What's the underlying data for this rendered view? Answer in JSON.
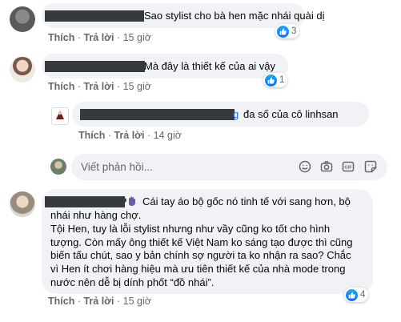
{
  "comments": [
    {
      "text": "Sao stylist cho bà hen mặc nhái quài dị",
      "actions": {
        "like": "Thích",
        "reply": "Trả lời",
        "time": "15 giờ"
      },
      "reaction_count": "3"
    },
    {
      "text": "Mà đây là thiết kế của ai vậy",
      "actions": {
        "like": "Thích",
        "reply": "Trả lời",
        "time": "15 giờ"
      },
      "reaction_count": "1"
    },
    {
      "text": "đa số của cô linhsan",
      "highlight_char": "g",
      "actions": {
        "like": "Thích",
        "reply": "Trả lời",
        "time": "14 giờ"
      }
    },
    {
      "first_line": "Cái tay áo bộ gốc nó tinh tế với sang hơn, bộ",
      "lines": [
        "nhái như hàng chợ.",
        "Tội Hen, tuy là lỗi stylist nhưng như vầy cũng ko tốt cho hình",
        "tượng. Còn mấy ông thiết kế Việt Nam ko sáng tạo được thì cũng",
        "biến tấu chút, sao y bản chính sợ người ta ko nhận ra sao? Chắc",
        "vì Hen ít chơi hàng hiệu mà ưu tiên thiết kế của nhà mode trong",
        "nước nên dễ bị dính phốt “đồ nhái”."
      ],
      "actions": {
        "like": "Thích",
        "reply": "Trả lời",
        "time": "15 giờ"
      },
      "reaction_count": "4"
    }
  ],
  "composer": {
    "placeholder": "Viết phản hồi...",
    "icons": [
      "emoji-icon",
      "camera-icon",
      "gif-icon",
      "sticker-icon"
    ]
  },
  "colors": {
    "bubble": "#f0f2f5",
    "meta": "#65676b",
    "like_blue": "#0866ff",
    "link_blue": "#216fdb"
  }
}
